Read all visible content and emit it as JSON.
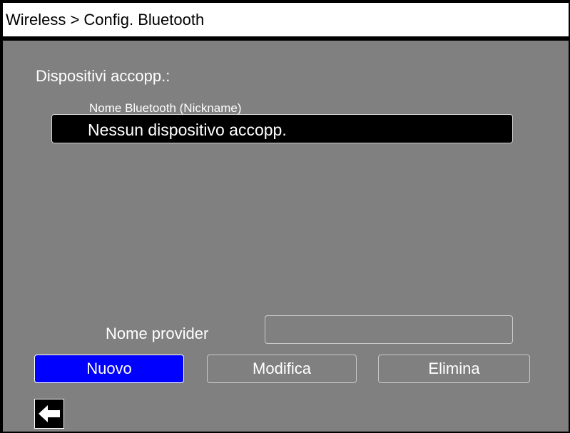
{
  "header": {
    "title": "Wireless > Config. Bluetooth"
  },
  "paired_devices": {
    "label": "Dispositivi accopp.:",
    "column_header": "Nome Bluetooth (Nickname)",
    "rows": [
      "Nessun dispositivo accopp."
    ]
  },
  "provider": {
    "label": "Nome provider",
    "value": ""
  },
  "buttons": {
    "new_label": "Nuovo",
    "edit_label": "Modifica",
    "delete_label": "Elimina"
  },
  "icons": {
    "back": "back-arrow-icon"
  },
  "colors": {
    "background": "#808080",
    "selected_button": "#0000ff",
    "title_bar": "#ffffff"
  }
}
